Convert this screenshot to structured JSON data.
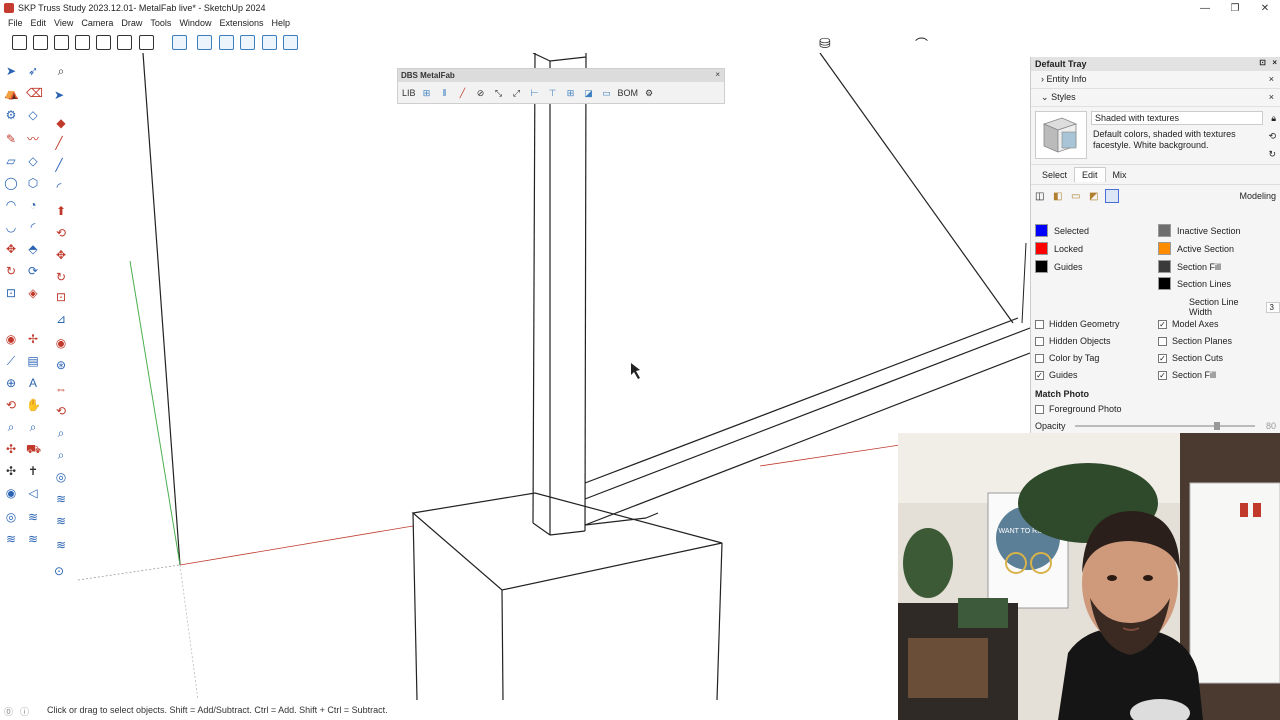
{
  "window": {
    "title": "SKP Truss Study 2023.12.01- MetalFab live* - SketchUp 2024",
    "minimize": "—",
    "restore": "❐",
    "close": "✕"
  },
  "menu": [
    "File",
    "Edit",
    "View",
    "Camera",
    "Draw",
    "Tools",
    "Window",
    "Extensions",
    "Help"
  ],
  "metalfab": {
    "title": "DBS MetalFab",
    "lib": "LIB",
    "bom": "BOM",
    "close": "×"
  },
  "tray": {
    "title": "Default Tray",
    "sections": {
      "entity_info": "Entity Info",
      "styles": "Styles"
    },
    "style_name": "Shaded with textures",
    "style_desc": "Default colors, shaded with textures facestyle. White background.",
    "tabs": [
      "Select",
      "Edit",
      "Mix"
    ],
    "active_tab": "Edit",
    "modeling_label": "Modeling",
    "colors_left": [
      {
        "label": "Selected",
        "color": "#0000ff"
      },
      {
        "label": "Locked",
        "color": "#ff0000"
      },
      {
        "label": "Guides",
        "color": "#000000"
      }
    ],
    "colors_right": [
      {
        "label": "Inactive Section",
        "color": "#6e6e6e"
      },
      {
        "label": "Active Section",
        "color": "#ff8c00"
      },
      {
        "label": "Section Fill",
        "color": "#3a3a3a"
      },
      {
        "label": "Section Lines",
        "color": "#000000"
      }
    ],
    "section_line_width_label": "Section Line Width",
    "section_line_width": "3",
    "checks_left": [
      {
        "label": "Hidden Geometry",
        "checked": false
      },
      {
        "label": "Hidden Objects",
        "checked": false
      },
      {
        "label": "Color by Tag",
        "checked": false
      },
      {
        "label": "Guides",
        "checked": true
      }
    ],
    "checks_right": [
      {
        "label": "Model Axes",
        "checked": true
      },
      {
        "label": "Section Planes",
        "checked": false
      },
      {
        "label": "Section Cuts",
        "checked": true
      },
      {
        "label": "Section Fill",
        "checked": true
      }
    ],
    "match_photo": "Match Photo",
    "foreground_photo": "Foreground Photo",
    "opacity_label": "Opacity",
    "opacity_value": "80"
  },
  "statusbar": {
    "text": "Click or drag to select objects. Shift = Add/Subtract. Ctrl = Add. Shift + Ctrl = Subtract."
  },
  "webcam": {
    "poster_text": "I WANT TO RIDE MY"
  }
}
